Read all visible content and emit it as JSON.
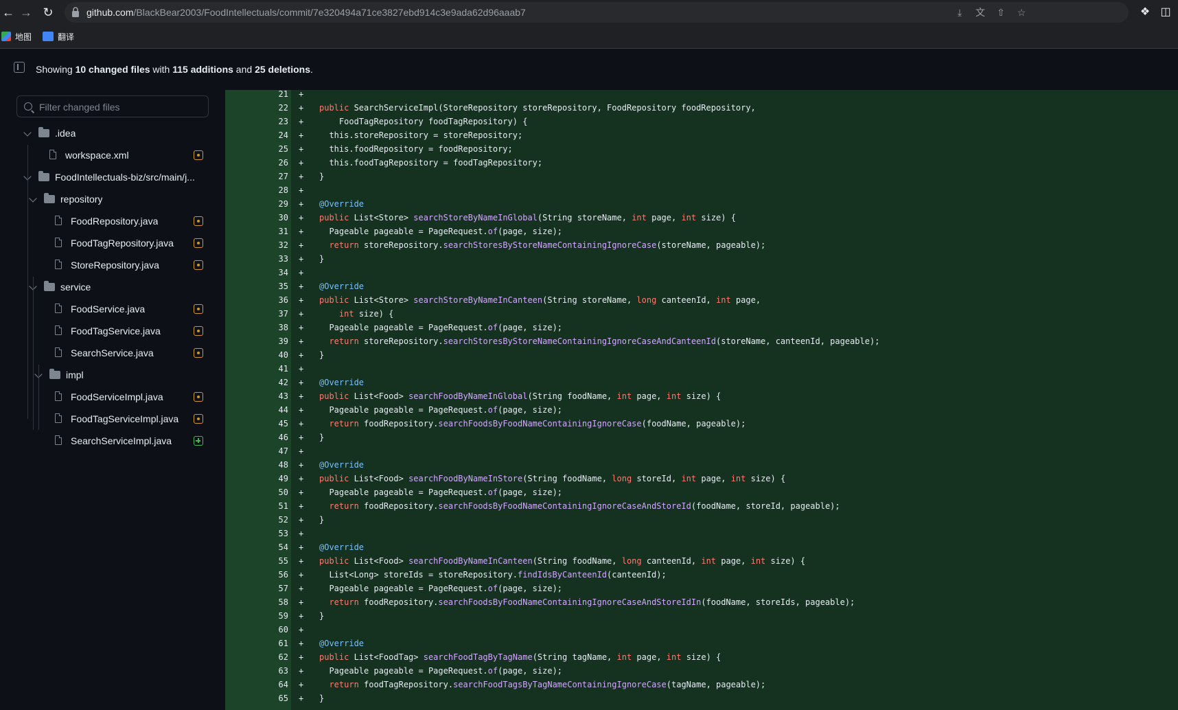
{
  "browser": {
    "url_host": "github.com",
    "url_path": "/BlackBear2003/FoodIntellectuals/commit/7e320494a71ce3827ebd914c3e9ada62d96aaab7",
    "bookmarks": [
      {
        "label": "地图",
        "icon": "maps-icon"
      },
      {
        "label": "翻译",
        "icon": "translate-icon"
      }
    ]
  },
  "summary": {
    "prefix": "Showing ",
    "files_changed": "10 changed files",
    "with": " with ",
    "additions": "115 additions",
    "and": " and ",
    "deletions": "25 deletions",
    "suffix": "."
  },
  "file_tree": {
    "filter_placeholder": "Filter changed files",
    "items": [
      {
        "type": "folder",
        "label": ".idea",
        "depth": 0
      },
      {
        "type": "file",
        "label": "workspace.xml",
        "depth": 1,
        "status": "modified"
      },
      {
        "type": "folder",
        "label": "FoodIntellectuals-biz/src/main/j...",
        "depth": 0
      },
      {
        "type": "folder",
        "label": "repository",
        "depth": 1
      },
      {
        "type": "file",
        "label": "FoodRepository.java",
        "depth": 2,
        "status": "modified"
      },
      {
        "type": "file",
        "label": "FoodTagRepository.java",
        "depth": 2,
        "status": "modified"
      },
      {
        "type": "file",
        "label": "StoreRepository.java",
        "depth": 2,
        "status": "modified"
      },
      {
        "type": "folder",
        "label": "service",
        "depth": 1
      },
      {
        "type": "file",
        "label": "FoodService.java",
        "depth": 2,
        "status": "modified"
      },
      {
        "type": "file",
        "label": "FoodTagService.java",
        "depth": 2,
        "status": "modified"
      },
      {
        "type": "file",
        "label": "SearchService.java",
        "depth": 2,
        "status": "modified"
      },
      {
        "type": "folder",
        "label": "impl",
        "depth": 2
      },
      {
        "type": "file",
        "label": "FoodServiceImpl.java",
        "depth": 3,
        "status": "modified"
      },
      {
        "type": "file",
        "label": "FoodTagServiceImpl.java",
        "depth": 3,
        "status": "modified"
      },
      {
        "type": "file",
        "label": "SearchServiceImpl.java",
        "depth": 3,
        "status": "added"
      }
    ]
  },
  "diff": {
    "marker": "+",
    "lines": [
      {
        "n": "21",
        "t": [
          [
            "",
            ""
          ]
        ]
      },
      {
        "n": "22",
        "t": [
          [
            "kw",
            "public"
          ],
          [
            "",
            " SearchServiceImpl(StoreRepository storeRepository, FoodRepository foodRepository,"
          ]
        ]
      },
      {
        "n": "23",
        "t": [
          [
            "",
            "    FoodTagRepository foodTagRepository) {"
          ]
        ]
      },
      {
        "n": "24",
        "t": [
          [
            "",
            "  this.storeRepository = storeRepository;"
          ]
        ]
      },
      {
        "n": "25",
        "t": [
          [
            "",
            "  this.foodRepository = foodRepository;"
          ]
        ]
      },
      {
        "n": "26",
        "t": [
          [
            "",
            "  this.foodTagRepository = foodTagRepository;"
          ]
        ]
      },
      {
        "n": "27",
        "t": [
          [
            "",
            "}"
          ]
        ]
      },
      {
        "n": "28",
        "t": [
          [
            "",
            ""
          ]
        ]
      },
      {
        "n": "29",
        "t": [
          [
            "ann",
            "@Override"
          ]
        ]
      },
      {
        "n": "30",
        "t": [
          [
            "kw",
            "public"
          ],
          [
            "",
            " List<Store> "
          ],
          [
            "fn",
            "searchStoreByNameInGlobal"
          ],
          [
            "",
            "(String storeName, "
          ],
          [
            "kw",
            "int"
          ],
          [
            "",
            " page, "
          ],
          [
            "kw",
            "int"
          ],
          [
            "",
            " size) {"
          ]
        ]
      },
      {
        "n": "31",
        "t": [
          [
            "",
            "  Pageable pageable = PageRequest."
          ],
          [
            "fn",
            "of"
          ],
          [
            "",
            "(page, size);"
          ]
        ]
      },
      {
        "n": "32",
        "t": [
          [
            "",
            "  "
          ],
          [
            "kw",
            "return"
          ],
          [
            "",
            " storeRepository."
          ],
          [
            "fn",
            "searchStoresByStoreNameContainingIgnoreCase"
          ],
          [
            "",
            "(storeName, pageable);"
          ]
        ]
      },
      {
        "n": "33",
        "t": [
          [
            "",
            "}"
          ]
        ]
      },
      {
        "n": "34",
        "t": [
          [
            "",
            ""
          ]
        ]
      },
      {
        "n": "35",
        "t": [
          [
            "ann",
            "@Override"
          ]
        ]
      },
      {
        "n": "36",
        "t": [
          [
            "kw",
            "public"
          ],
          [
            "",
            " List<Store> "
          ],
          [
            "fn",
            "searchStoreByNameInCanteen"
          ],
          [
            "",
            "(String storeName, "
          ],
          [
            "kw",
            "long"
          ],
          [
            "",
            " canteenId, "
          ],
          [
            "kw",
            "int"
          ],
          [
            "",
            " page,"
          ]
        ]
      },
      {
        "n": "37",
        "t": [
          [
            "",
            "    "
          ],
          [
            "kw",
            "int"
          ],
          [
            "",
            " size) {"
          ]
        ]
      },
      {
        "n": "38",
        "t": [
          [
            "",
            "  Pageable pageable = PageRequest."
          ],
          [
            "fn",
            "of"
          ],
          [
            "",
            "(page, size);"
          ]
        ]
      },
      {
        "n": "39",
        "t": [
          [
            "",
            "  "
          ],
          [
            "kw",
            "return"
          ],
          [
            "",
            " storeRepository."
          ],
          [
            "fn",
            "searchStoresByStoreNameContainingIgnoreCaseAndCanteenId"
          ],
          [
            "",
            "(storeName, canteenId, pageable);"
          ]
        ]
      },
      {
        "n": "40",
        "t": [
          [
            "",
            "}"
          ]
        ]
      },
      {
        "n": "41",
        "t": [
          [
            "",
            ""
          ]
        ]
      },
      {
        "n": "42",
        "t": [
          [
            "ann",
            "@Override"
          ]
        ]
      },
      {
        "n": "43",
        "t": [
          [
            "kw",
            "public"
          ],
          [
            "",
            " List<Food> "
          ],
          [
            "fn",
            "searchFoodByNameInGlobal"
          ],
          [
            "",
            "(String foodName, "
          ],
          [
            "kw",
            "int"
          ],
          [
            "",
            " page, "
          ],
          [
            "kw",
            "int"
          ],
          [
            "",
            " size) {"
          ]
        ]
      },
      {
        "n": "44",
        "t": [
          [
            "",
            "  Pageable pageable = PageRequest."
          ],
          [
            "fn",
            "of"
          ],
          [
            "",
            "(page, size);"
          ]
        ]
      },
      {
        "n": "45",
        "t": [
          [
            "",
            "  "
          ],
          [
            "kw",
            "return"
          ],
          [
            "",
            " foodRepository."
          ],
          [
            "fn",
            "searchFoodsByFoodNameContainingIgnoreCase"
          ],
          [
            "",
            "(foodName, pageable);"
          ]
        ]
      },
      {
        "n": "46",
        "t": [
          [
            "",
            "}"
          ]
        ]
      },
      {
        "n": "47",
        "t": [
          [
            "",
            ""
          ]
        ]
      },
      {
        "n": "48",
        "t": [
          [
            "ann",
            "@Override"
          ]
        ]
      },
      {
        "n": "49",
        "t": [
          [
            "kw",
            "public"
          ],
          [
            "",
            " List<Food> "
          ],
          [
            "fn",
            "searchFoodByNameInStore"
          ],
          [
            "",
            "(String foodName, "
          ],
          [
            "kw",
            "long"
          ],
          [
            "",
            " storeId, "
          ],
          [
            "kw",
            "int"
          ],
          [
            "",
            " page, "
          ],
          [
            "kw",
            "int"
          ],
          [
            "",
            " size) {"
          ]
        ]
      },
      {
        "n": "50",
        "t": [
          [
            "",
            "  Pageable pageable = PageRequest."
          ],
          [
            "fn",
            "of"
          ],
          [
            "",
            "(page, size);"
          ]
        ]
      },
      {
        "n": "51",
        "t": [
          [
            "",
            "  "
          ],
          [
            "kw",
            "return"
          ],
          [
            "",
            " foodRepository."
          ],
          [
            "fn",
            "searchFoodsByFoodNameContainingIgnoreCaseAndStoreId"
          ],
          [
            "",
            "(foodName, storeId, pageable);"
          ]
        ]
      },
      {
        "n": "52",
        "t": [
          [
            "",
            "}"
          ]
        ]
      },
      {
        "n": "53",
        "t": [
          [
            "",
            ""
          ]
        ]
      },
      {
        "n": "54",
        "t": [
          [
            "ann",
            "@Override"
          ]
        ]
      },
      {
        "n": "55",
        "t": [
          [
            "kw",
            "public"
          ],
          [
            "",
            " List<Food> "
          ],
          [
            "fn",
            "searchFoodByNameInCanteen"
          ],
          [
            "",
            "(String foodName, "
          ],
          [
            "kw",
            "long"
          ],
          [
            "",
            " canteenId, "
          ],
          [
            "kw",
            "int"
          ],
          [
            "",
            " page, "
          ],
          [
            "kw",
            "int"
          ],
          [
            "",
            " size) {"
          ]
        ]
      },
      {
        "n": "56",
        "t": [
          [
            "",
            "  List<Long> storeIds = storeRepository."
          ],
          [
            "fn",
            "findIdsByCanteenId"
          ],
          [
            "",
            "(canteenId);"
          ]
        ]
      },
      {
        "n": "57",
        "t": [
          [
            "",
            "  Pageable pageable = PageRequest."
          ],
          [
            "fn",
            "of"
          ],
          [
            "",
            "(page, size);"
          ]
        ]
      },
      {
        "n": "58",
        "t": [
          [
            "",
            "  "
          ],
          [
            "kw",
            "return"
          ],
          [
            "",
            " foodRepository."
          ],
          [
            "fn",
            "searchFoodsByFoodNameContainingIgnoreCaseAndStoreIdIn"
          ],
          [
            "",
            "(foodName, storeIds, pageable);"
          ]
        ]
      },
      {
        "n": "59",
        "t": [
          [
            "",
            "}"
          ]
        ]
      },
      {
        "n": "60",
        "t": [
          [
            "",
            ""
          ]
        ]
      },
      {
        "n": "61",
        "t": [
          [
            "ann",
            "@Override"
          ]
        ]
      },
      {
        "n": "62",
        "t": [
          [
            "kw",
            "public"
          ],
          [
            "",
            " List<FoodTag> "
          ],
          [
            "fn",
            "searchFoodTagByTagName"
          ],
          [
            "",
            "(String tagName, "
          ],
          [
            "kw",
            "int"
          ],
          [
            "",
            " page, "
          ],
          [
            "kw",
            "int"
          ],
          [
            "",
            " size) {"
          ]
        ]
      },
      {
        "n": "63",
        "t": [
          [
            "",
            "  Pageable pageable = PageRequest."
          ],
          [
            "fn",
            "of"
          ],
          [
            "",
            "(page, size);"
          ]
        ]
      },
      {
        "n": "64",
        "t": [
          [
            "",
            "  "
          ],
          [
            "kw",
            "return"
          ],
          [
            "",
            " foodTagRepository."
          ],
          [
            "fn",
            "searchFoodTagsByTagNameContainingIgnoreCase"
          ],
          [
            "",
            "(tagName, pageable);"
          ]
        ]
      },
      {
        "n": "65",
        "t": [
          [
            "",
            "}"
          ]
        ]
      }
    ]
  }
}
